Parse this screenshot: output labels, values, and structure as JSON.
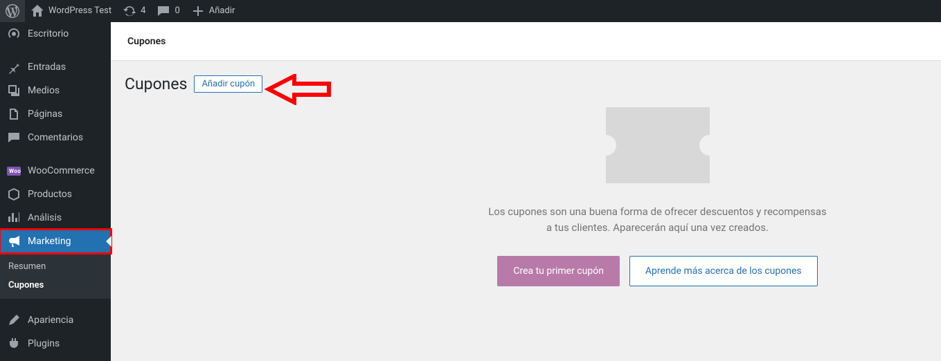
{
  "adminBar": {
    "siteName": "WordPress Test",
    "updatesCount": "4",
    "commentsCount": "0",
    "addNewLabel": "Añadir"
  },
  "menu": {
    "dashboard": "Escritorio",
    "posts": "Entradas",
    "media": "Medios",
    "pages": "Páginas",
    "comments": "Comentarios",
    "woocommerce": "WooCommerce",
    "products": "Productos",
    "analytics": "Análisis",
    "marketing": "Marketing",
    "marketingSub": {
      "overview": "Resumen",
      "coupons": "Cupones"
    },
    "appearance": "Apariencia",
    "plugins": "Plugins"
  },
  "breadcrumb": "Cupones",
  "page": {
    "heading": "Cupones",
    "addCoupon": "Añadir cupón",
    "emptyText": "Los cupones son una buena forma de ofrecer descuentos y recompensas a tus clientes. Aparecerán aquí una vez creados.",
    "primaryBtn": "Crea tu primer cupón",
    "secondaryBtn": "Aprende más acerca de los cupones"
  }
}
